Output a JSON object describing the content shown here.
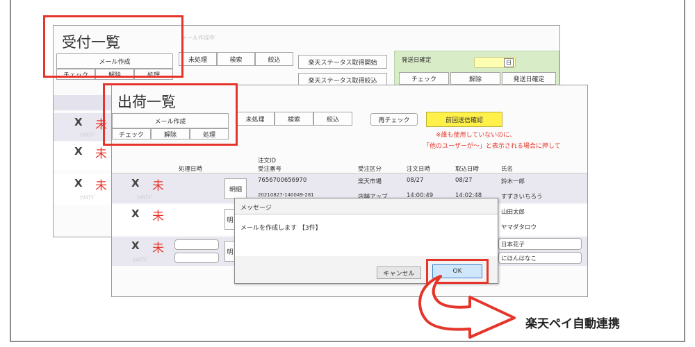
{
  "reception": {
    "title": "受付一覧",
    "faint_header": "メール作成中",
    "mail_button": "メール作成",
    "check": "チェック",
    "release": "解除",
    "process": "処理",
    "unprocessed": "未処理",
    "search": "検索",
    "filter": "絞込",
    "status_start": "楽天ステータス取得開始",
    "status_filter": "楽天ステータス取得絞込",
    "ship_date_confirm": "発送日確定",
    "date_icon": "日",
    "ship_check": "チェック",
    "ship_release": "解除",
    "ship_date_fix": "発送日確定",
    "rows": [
      {
        "x": "X",
        "status": "未",
        "sub": "ﾂﾒﾙｱﾄﾞ"
      },
      {
        "x": "X",
        "status": "未",
        "sub": ""
      },
      {
        "x": "X",
        "status": "未",
        "sub": "ﾂﾒﾙｱﾄﾞ"
      }
    ]
  },
  "shipping": {
    "title": "出荷一覧",
    "mail_button": "メール作成",
    "check": "チェック",
    "release": "解除",
    "process": "処理",
    "unprocessed": "未処理",
    "search": "検索",
    "filter": "絞込",
    "recheck": "再チェック",
    "yellow_button": "前回送信確認",
    "notice_1": "※誰も使用していないのに、",
    "notice_2": "「他のユーザーが～」と表示される場合に押して",
    "columns": {
      "processed_at": "処理日時",
      "order_id": "注文ID",
      "receipt_no": "受注番号",
      "receipt_type": "受注区分",
      "order_date": "注文日時",
      "import_date": "取込日時",
      "name": "氏名"
    },
    "rows": [
      {
        "x": "X",
        "status": "未",
        "sub": "ﾂﾒﾙｱﾄﾞ",
        "detail": "明細",
        "order_no": "7656700656970",
        "order_sub": "20210827-140049-281",
        "type": "楽天市場",
        "type_sub": "店舗アップ",
        "order_date": "08/27",
        "order_time": "14:00:49",
        "import_date": "08/27",
        "import_time": "14:02:48",
        "name": "鈴木一郎",
        "name_kana": "すずきいちろう"
      },
      {
        "x": "X",
        "status": "未",
        "sub": "",
        "detail": "明",
        "name": "山田太郎",
        "name_kana": "ヤマダタロウ"
      },
      {
        "x": "X",
        "status": "未",
        "sub": "ﾂﾒﾙｱﾄﾞ",
        "detail": "明",
        "name": "日本花子",
        "name_kana": "にほんはなこ"
      }
    ]
  },
  "dialog": {
    "title": "メッセージ",
    "message": "メールを作成します 【3件】",
    "cancel": "キャンセル",
    "ok": "OK"
  },
  "callout": "楽天ペイ自動連携",
  "colors": {
    "accent_red": "#e5352a",
    "panel_green": "#d9ecc8",
    "yellow_button": "#fff04a"
  }
}
